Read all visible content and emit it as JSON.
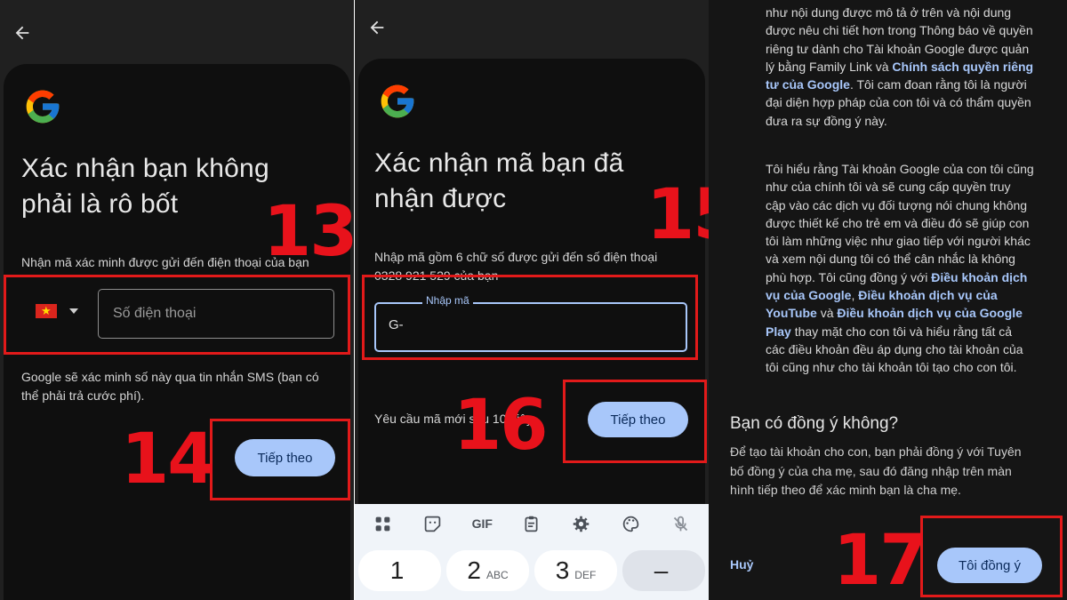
{
  "colors": {
    "accent": "#a8c7fa",
    "annotation_red": "#e21a1a",
    "sheet_bg": "#0f0f0f"
  },
  "icons": {
    "back": "arrow-left-icon",
    "logo": "google-g-logo"
  },
  "step13": {
    "number": "13",
    "title_line1": "Xác nhận bạn không",
    "title_line2": "phải là rô bốt",
    "instruction": "Nhận mã xác minh được gửi đến điện thoại của bạn",
    "country_flag": "vn-flag",
    "phone_placeholder": "Số điện thoại",
    "sms_note_line1": "Google sẽ xác minh số này qua tin nhắn SMS (bạn có",
    "sms_note_line2": "thể phải trả cước phí)."
  },
  "step14": {
    "number": "14",
    "next_label": "Tiếp theo"
  },
  "step15": {
    "number": "15",
    "title_line1": "Xác nhận mã bạn đã",
    "title_line2": "nhận được",
    "instruction_line1": "Nhập mã gồm 6 chữ số được gửi đến số điện thoại",
    "instruction_line2": "0328 921 529 của bạn",
    "code_label": "Nhập mã",
    "code_value": "G-"
  },
  "step16": {
    "number": "16",
    "resend_text": "Yêu cầu mã mới sau 10 giây",
    "next_label": "Tiếp theo"
  },
  "keyboard": {
    "tools": [
      "apps-icon",
      "sticker-icon",
      "GIF",
      "clipboard-icon",
      "settings-icon",
      "palette-icon",
      "mic-off-icon"
    ],
    "keys": [
      {
        "digit": "1",
        "letters": ""
      },
      {
        "digit": "2",
        "letters": "ABC"
      },
      {
        "digit": "3",
        "letters": "DEF"
      },
      {
        "digit": "–",
        "letters": ""
      }
    ]
  },
  "step17": {
    "number": "17",
    "para1_lines": [
      "như nội dung được mô tả ở trên và nội dung",
      "được nêu chi tiết hơn trong Thông báo về quyền",
      "riêng tư dành cho Tài khoản Google được quản",
      "lý bằng Family Link và ",
      "Chính sách quyền riêng",
      "tư của Google",
      ". Tôi cam đoan rằng tôi là người",
      "đại diện hợp pháp của con tôi và có thẩm quyền",
      "đưa ra sự đồng ý này."
    ],
    "para2_lines": [
      "Tôi hiểu rằng Tài khoản Google của con tôi cũng",
      "như của chính tôi và sẽ cung cấp quyền truy",
      "cập vào các dịch vụ đối tượng nói chung không",
      "được thiết kế cho trẻ em và điều đó sẽ giúp con",
      "tôi làm những việc như giao tiếp với người khác",
      "và xem nội dung tôi có thể cân nhắc là không",
      "phù hợp. Tôi cũng đồng ý với ",
      "Điều khoản dịch",
      "vụ của Google",
      ", ",
      "Điều khoản dịch vụ của",
      "YouTube",
      " và ",
      "Điều khoản dịch vụ của Google",
      "Play",
      " thay mặt cho con tôi và hiểu rằng tất cả",
      "các điều khoản đều áp dụng cho tài khoản của",
      "tôi cũng như cho tài khoản tôi tạo cho con tôi."
    ],
    "question": "Bạn có đồng ý không?",
    "sub_lines": [
      "Để tạo tài khoản cho con, bạn phải đồng ý với Tuyên",
      "bố đồng ý của cha mẹ, sau đó đăng nhập trên màn",
      "hình tiếp theo để xác minh bạn là cha mẹ."
    ],
    "cancel_label": "Huỷ",
    "agree_label": "Tôi đồng ý"
  }
}
